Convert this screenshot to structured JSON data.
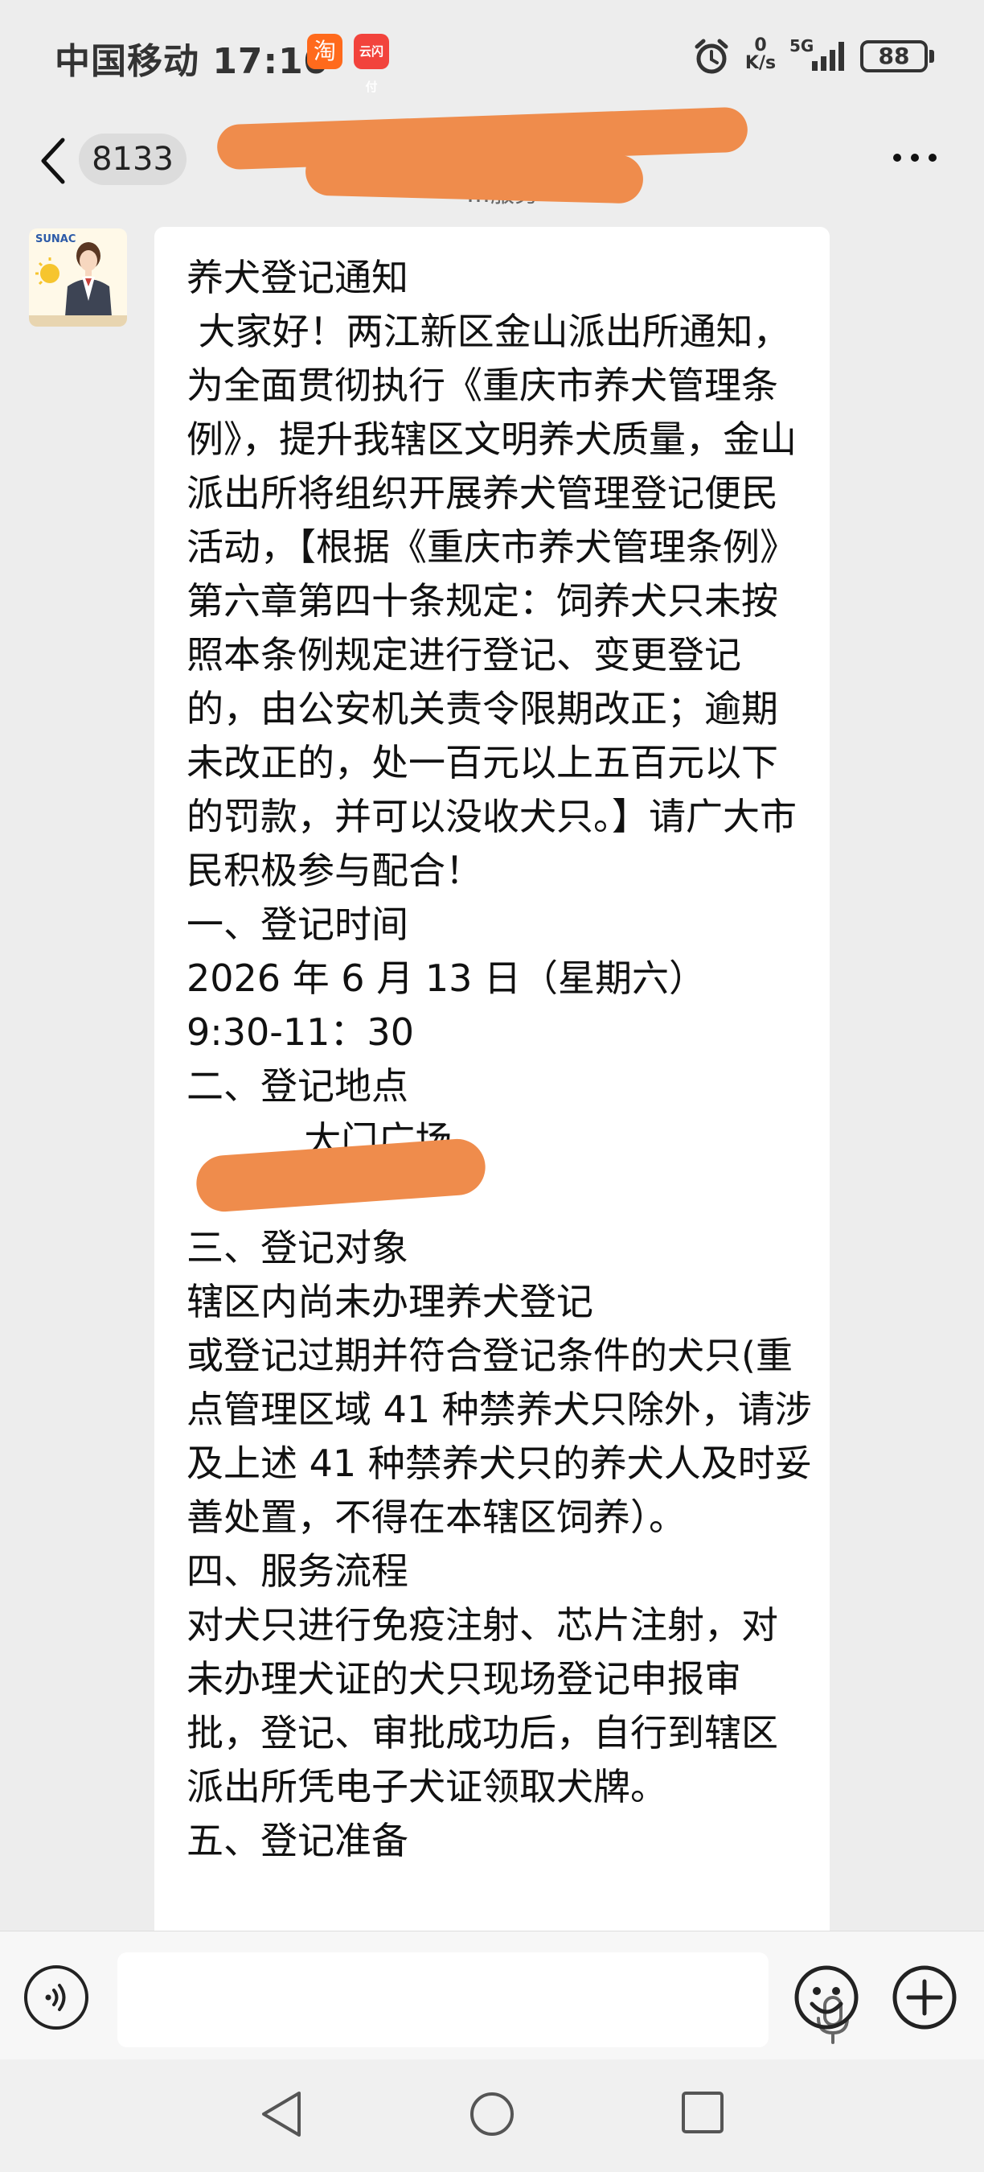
{
  "status_bar": {
    "carrier_time": "中国移动 17:10",
    "app1_glyph": "淘",
    "app2_glyph": "云闪付",
    "net_speed_value": "0",
    "net_speed_unit": "K/s",
    "network": "5G",
    "battery": "88"
  },
  "header": {
    "unread_count": "8133",
    "title": "",
    "subtitle": "…服务"
  },
  "avatar": {
    "brand": "SUNAC"
  },
  "message": {
    "text": "养犬登记通知\n 大家好！两江新区金山派出所通知，为全面贯彻执行《重庆市养犬管理条例》，提升我辖区文明养犬质量，金山派出所将组织开展养犬管理登记便民活动，【根据《重庆市养犬管理条例》第六章第四十条规定：饲养犬只未按照本条例规定进行登记、变更登记的，由公安机关责令限期改正；逾期未改正的，处一百元以上五百元以下的罚款，并可以没收犬只。】请广大市民积极参与配合！\n一、登记时间\n2026 年 6 月 13 日（星期六）\n9:30-11：30\n二、登记地点\n          大门广场\n\n三、登记对象\n辖区内尚未办理养犬登记\n或登记过期并符合登记条件的犬只(重点管理区域 41 种禁养犬只除外，请涉及上述 41 种禁养犬只的养犬人及时妥善处置，不得在本辖区饲养）。\n四、服务流程\n对犬只进行免疫注射、芯片注射，对未办理犬证的犬只现场登记申报审批，登记、审批成功后，自行到辖区派出所凭电子犬证领取犬牌。\n五、登记准备"
  },
  "icons": {
    "back": "back-chevron-icon",
    "more": "more-dots-icon",
    "voice": "voice-icon",
    "mic": "mic-icon",
    "emoji": "emoji-icon",
    "plus": "plus-icon"
  },
  "colors": {
    "background": "#ededed",
    "bubble": "#ffffff",
    "redaction": "#ef8c4c"
  }
}
